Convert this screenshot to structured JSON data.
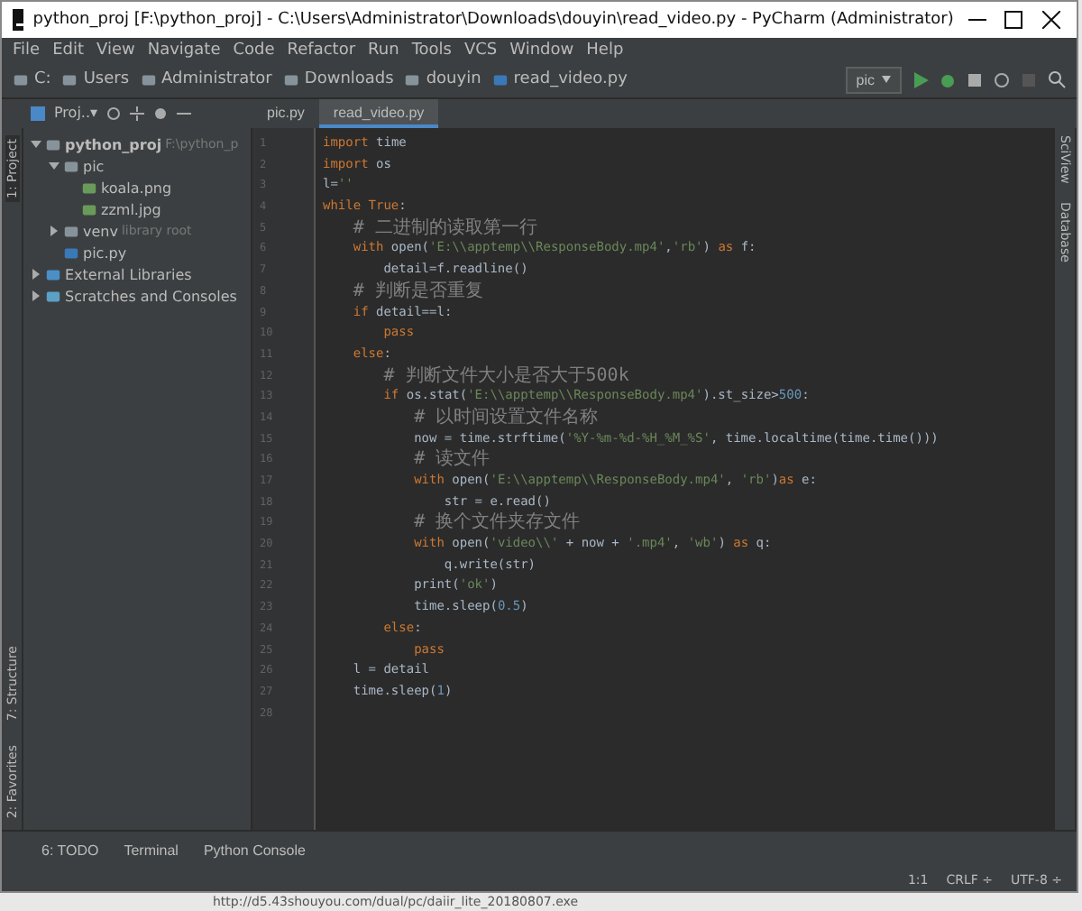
{
  "window": {
    "title": "python_proj [F:\\python_proj] - C:\\Users\\Administrator\\Downloads\\douyin\\read_video.py - PyCharm (Administrator)"
  },
  "menu": [
    "File",
    "Edit",
    "View",
    "Navigate",
    "Code",
    "Refactor",
    "Run",
    "Tools",
    "VCS",
    "Window",
    "Help"
  ],
  "breadcrumbs": [
    {
      "label": "C:",
      "kind": "folder"
    },
    {
      "label": "Users",
      "kind": "folder"
    },
    {
      "label": "Administrator",
      "kind": "folder"
    },
    {
      "label": "Downloads",
      "kind": "folder"
    },
    {
      "label": "douyin",
      "kind": "folder"
    },
    {
      "label": "read_video.py",
      "kind": "file"
    }
  ],
  "run_config": "pic",
  "left_strip": {
    "top": "1: Project",
    "bottom": [
      "7: Structure",
      "2: Favorites"
    ]
  },
  "right_strip": [
    "SciView",
    "Database"
  ],
  "project_panel": {
    "title": "Proj..▾"
  },
  "tree": [
    {
      "label": "python_proj",
      "hint": "F:\\python_p",
      "kind": "folder",
      "expanded": true,
      "children": [
        {
          "label": "pic",
          "kind": "folder",
          "expanded": true,
          "children": [
            {
              "label": "koala.png",
              "kind": "image"
            },
            {
              "label": "zzml.jpg",
              "kind": "image"
            }
          ]
        },
        {
          "label": "venv",
          "hint": "library root",
          "kind": "folder",
          "expanded": false
        },
        {
          "label": "pic.py",
          "kind": "py"
        }
      ]
    },
    {
      "label": "External Libraries",
      "kind": "lib",
      "expanded": false
    },
    {
      "label": "Scratches and Consoles",
      "kind": "scratch",
      "expanded": false
    }
  ],
  "tabs": [
    {
      "label": "pic.py",
      "selected": false
    },
    {
      "label": "read_video.py",
      "selected": true
    }
  ],
  "line_numbers": [
    "1",
    "2",
    "3",
    "4",
    "5",
    "6",
    "7",
    "8",
    "9",
    "10",
    "11",
    "12",
    "13",
    "14",
    "15",
    "16",
    "17",
    "18",
    "19",
    "20",
    "21",
    "22",
    "23",
    "24",
    "25",
    "26",
    "27",
    "28"
  ],
  "code": [
    [
      {
        "kind": "keyword",
        "text": "import"
      },
      {
        "kind": "plain",
        "text": " time"
      }
    ],
    [
      {
        "kind": "keyword",
        "text": "import"
      },
      {
        "kind": "plain",
        "text": " os"
      }
    ],
    [
      {
        "kind": "plain",
        "text": "l="
      },
      {
        "kind": "string",
        "text": "''"
      }
    ],
    [
      {
        "kind": "keyword",
        "text": "while True"
      },
      {
        "kind": "plain",
        "text": ":"
      }
    ],
    [
      {
        "kind": "comment",
        "text": "    # 二进制的读取第一行"
      }
    ],
    [
      {
        "kind": "keyword",
        "text": "    with"
      },
      {
        "kind": "plain",
        "text": " open("
      },
      {
        "kind": "string",
        "text": "'E:\\\\apptemp\\\\ResponseBody.mp4'"
      },
      {
        "kind": "plain",
        "text": ","
      },
      {
        "kind": "string",
        "text": "'rb'"
      },
      {
        "kind": "plain",
        "text": ") "
      },
      {
        "kind": "keyword",
        "text": "as"
      },
      {
        "kind": "plain",
        "text": " f:"
      }
    ],
    [
      {
        "kind": "plain",
        "text": "        detail=f.readline()"
      }
    ],
    [
      {
        "kind": "comment",
        "text": "    # 判断是否重复"
      }
    ],
    [
      {
        "kind": "keyword",
        "text": "    if"
      },
      {
        "kind": "plain",
        "text": " detail==l:"
      }
    ],
    [
      {
        "kind": "keyword",
        "text": "        pass"
      }
    ],
    [
      {
        "kind": "keyword",
        "text": "    else"
      },
      {
        "kind": "plain",
        "text": ":"
      }
    ],
    [
      {
        "kind": "comment",
        "text": "        # 判断文件大小是否大于500k"
      }
    ],
    [
      {
        "kind": "keyword",
        "text": "        if"
      },
      {
        "kind": "plain",
        "text": " os.stat("
      },
      {
        "kind": "string",
        "text": "'E:\\\\apptemp\\\\ResponseBody.mp4'"
      },
      {
        "kind": "plain",
        "text": ").st_size>"
      },
      {
        "kind": "number",
        "text": "500"
      },
      {
        "kind": "plain",
        "text": ":"
      }
    ],
    [
      {
        "kind": "comment",
        "text": "            # 以时间设置文件名称"
      }
    ],
    [
      {
        "kind": "plain",
        "text": "            now = time.strftime("
      },
      {
        "kind": "string",
        "text": "'%Y-%m-%d-%H_%M_%S'"
      },
      {
        "kind": "plain",
        "text": ", time.localtime(time.time()))"
      }
    ],
    [
      {
        "kind": "comment",
        "text": "            # 读文件"
      }
    ],
    [
      {
        "kind": "keyword",
        "text": "            with"
      },
      {
        "kind": "plain",
        "text": " open("
      },
      {
        "kind": "string",
        "text": "'E:\\\\apptemp\\\\ResponseBody.mp4'"
      },
      {
        "kind": "plain",
        "text": ", "
      },
      {
        "kind": "string",
        "text": "'rb'"
      },
      {
        "kind": "plain",
        "text": ")"
      },
      {
        "kind": "keyword",
        "text": "as"
      },
      {
        "kind": "plain",
        "text": " e:"
      }
    ],
    [
      {
        "kind": "plain",
        "text": "                str = e.read()"
      }
    ],
    [
      {
        "kind": "comment",
        "text": "            # 换个文件夹存文件"
      }
    ],
    [
      {
        "kind": "keyword",
        "text": "            with"
      },
      {
        "kind": "plain",
        "text": " open("
      },
      {
        "kind": "string",
        "text": "'video\\\\'"
      },
      {
        "kind": "plain",
        "text": " + now + "
      },
      {
        "kind": "string",
        "text": "'.mp4'"
      },
      {
        "kind": "plain",
        "text": ", "
      },
      {
        "kind": "string",
        "text": "'wb'"
      },
      {
        "kind": "plain",
        "text": ") "
      },
      {
        "kind": "keyword",
        "text": "as"
      },
      {
        "kind": "plain",
        "text": " q:"
      }
    ],
    [
      {
        "kind": "plain",
        "text": "                q.write(str)"
      }
    ],
    [
      {
        "kind": "plain",
        "text": "            print("
      },
      {
        "kind": "string",
        "text": "'ok'"
      },
      {
        "kind": "plain",
        "text": ")"
      }
    ],
    [
      {
        "kind": "plain",
        "text": "            time.sleep("
      },
      {
        "kind": "number",
        "text": "0.5"
      },
      {
        "kind": "plain",
        "text": ")"
      }
    ],
    [
      {
        "kind": "keyword",
        "text": "        else"
      },
      {
        "kind": "plain",
        "text": ":"
      }
    ],
    [
      {
        "kind": "keyword",
        "text": "            pass"
      }
    ],
    [
      {
        "kind": "plain",
        "text": "    l = detail"
      }
    ],
    [
      {
        "kind": "plain",
        "text": "    time.sleep("
      },
      {
        "kind": "number",
        "text": "1"
      },
      {
        "kind": "plain",
        "text": ")"
      }
    ]
  ],
  "tool_windows": [
    "6: TODO",
    "Terminal",
    "Python Console"
  ],
  "status": [
    "1:1",
    "CRLF ÷",
    "UTF-8 ÷"
  ],
  "desktop_text": "http://d5.43shouyou.com/dual/pc/daiir_lite_20180807.exe"
}
